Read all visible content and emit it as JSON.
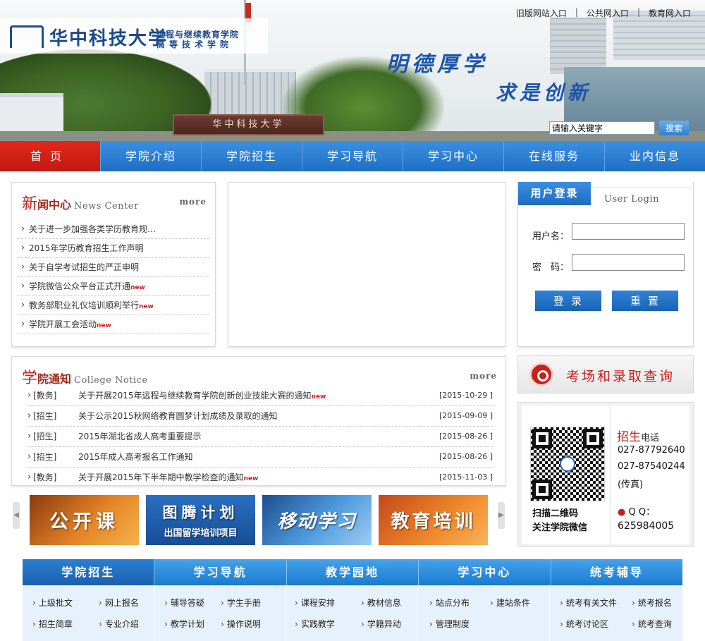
{
  "header": {
    "toplinks": [
      "旧版网站入口",
      "公共网入口",
      "教育网入口"
    ],
    "toplink_sep": "|",
    "logo_cn": "华中科技大学",
    "logo_sub1": "远程与继续教育学院",
    "logo_sub2": "高等技术学院",
    "motto1": "明德厚学",
    "motto2": "求是创新",
    "gate_sign": "华中科技大学",
    "search_placeholder": "请输入关键字",
    "search_button": "搜索"
  },
  "nav": [
    "首页",
    "学院介绍",
    "学院招生",
    "学习导航",
    "学习中心",
    "在线服务",
    "业内信息"
  ],
  "news": {
    "title_big": "新",
    "title_rest": "闻中心",
    "title_en": "News Center",
    "more": "more",
    "items": [
      {
        "text": "关于进一步加强各类学历教育规…",
        "new": ""
      },
      {
        "text": "2015年学历教育招生工作声明",
        "new": ""
      },
      {
        "text": "关于自学考试招生的严正申明",
        "new": ""
      },
      {
        "text": "学院微信公众平台正式开通",
        "new": "new"
      },
      {
        "text": "教务部职业礼仪培训顺利举行",
        "new": "new"
      },
      {
        "text": "学院开展工会活动",
        "new": "new"
      }
    ]
  },
  "notice": {
    "title_big": "学",
    "title_rest": "院通知",
    "title_en": "College Notice",
    "more": "more",
    "items": [
      {
        "cat": "[教务]",
        "text": "关于开展2015年远程与继续教育学院创新创业技能大赛的通知",
        "new": "new",
        "date": "[2015-10-29 ]"
      },
      {
        "cat": "[招生]",
        "text": "关于公示2015秋网络教育圆梦计划成绩及录取的通知",
        "new": "",
        "date": "[2015-09-09 ]"
      },
      {
        "cat": "[招生]",
        "text": "2015年湖北省成人高考重要提示",
        "new": "",
        "date": "[2015-08-26 ]"
      },
      {
        "cat": "[招生]",
        "text": "2015年成人高考报名工作通知",
        "new": "",
        "date": "[2015-08-26 ]"
      },
      {
        "cat": "[教务]",
        "text": "关于开展2015年下半年期中教学检查的通知",
        "new": "new",
        "date": "[2015-11-03 ]"
      }
    ]
  },
  "login": {
    "tab": "用户登录",
    "en": "User Login",
    "username_label": "用户名：",
    "password_label": "密　码：",
    "login_button": "登录",
    "reset_button": "重置"
  },
  "query": {
    "text": "考场和录取查询"
  },
  "contact": {
    "qr_caption1": "扫描二维码",
    "qr_caption2": "关注学院微信",
    "title_red": "招生",
    "title_rest": "电话",
    "phone1": "027-87792640",
    "phone2": "027-87540244",
    "fax": "(传真)",
    "qq_label": "Q Q：",
    "qq": "625984005"
  },
  "banners": [
    {
      "main": "公开课",
      "sub": "",
      "color": "#d8741c"
    },
    {
      "main": "图腾计划",
      "sub": "出国留学培训项目",
      "color": "#1d5fa8"
    },
    {
      "main": "移动学习",
      "sub": "",
      "color": "#3a86cc"
    },
    {
      "main": "教育培训",
      "sub": "",
      "color": "#e06a1a"
    }
  ],
  "bottom": {
    "tabs": [
      "学院招生",
      "学习导航",
      "教学园地",
      "学习中心",
      "统考辅导"
    ],
    "columns": [
      [
        "上级批文",
        "网上报名",
        "招生简章",
        "专业介绍"
      ],
      [
        "辅导答疑",
        "学生手册",
        "教学计划",
        "操作说明"
      ],
      [
        "课程安排",
        "教材信息",
        "实践教学",
        "学籍异动"
      ],
      [
        "站点分布",
        "建站条件",
        "管理制度",
        ""
      ],
      [
        "统考有关文件",
        "统考报名",
        "统考讨论区",
        "统考查询"
      ]
    ]
  }
}
